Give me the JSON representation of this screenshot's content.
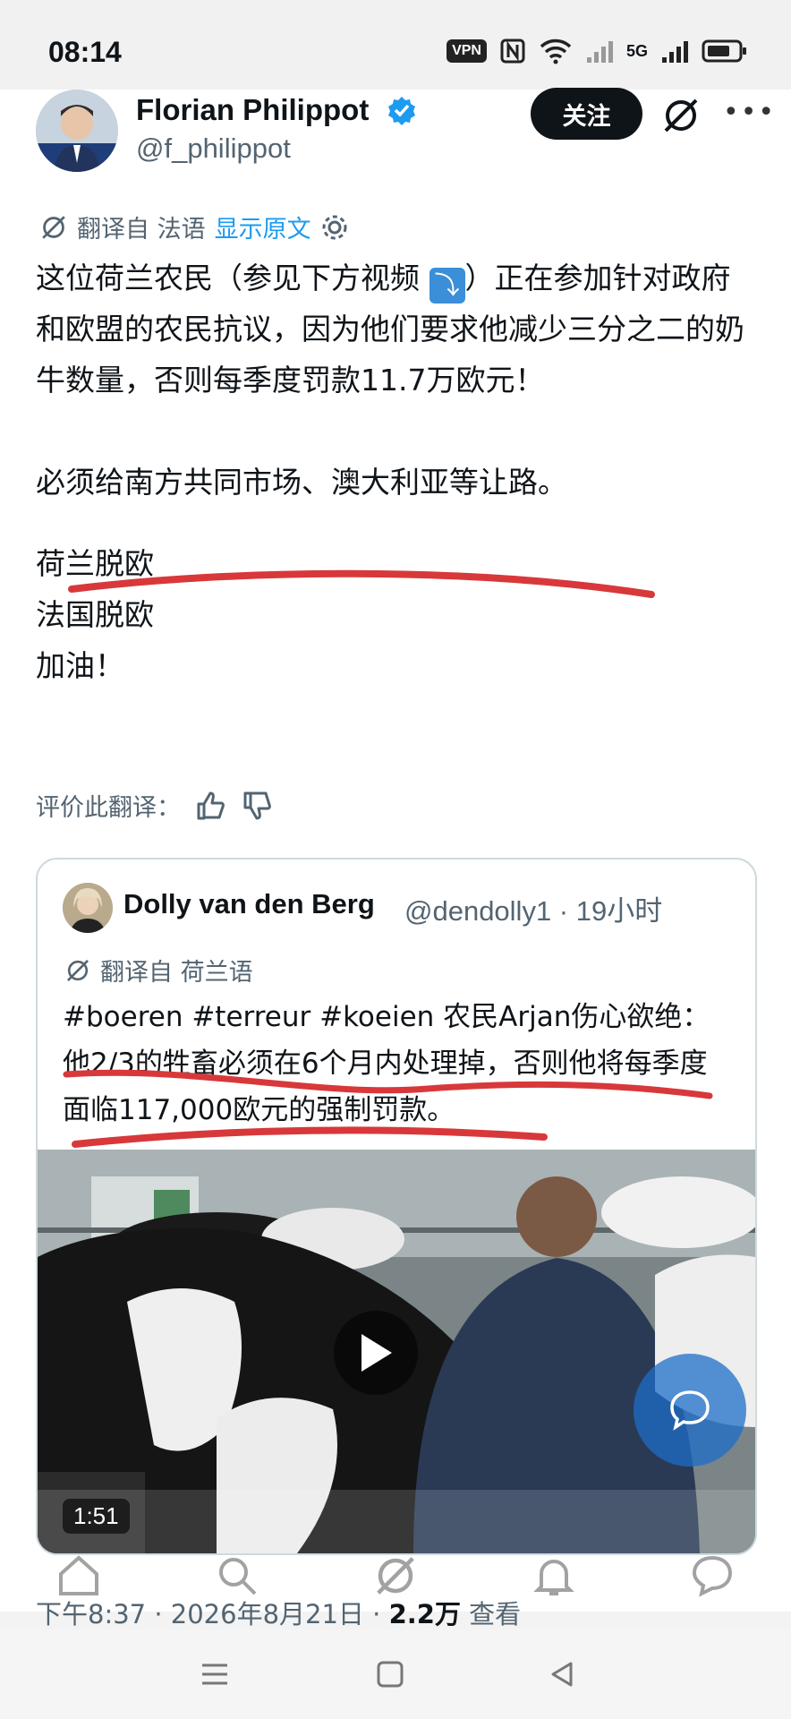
{
  "status_bar": {
    "time": "08:14",
    "vpn": "VPN",
    "signal_label": "5G"
  },
  "author": {
    "name": "Florian Philippot",
    "handle": "@f_philippot",
    "follow_label": "关注"
  },
  "translation": {
    "prefix": "翻译自 法语",
    "show_original": "显示原文"
  },
  "tweet": {
    "line1_a": "这位荷兰农民（参见下方视频",
    "arrow_glyph": "⤵",
    "line1_b": "）正在参加针对政府和欧盟的农民抗议，因为他们要求他减少三分之二的奶牛数量，否则每季度罚款11.7万欧元！",
    "paragraph2": "必须给南方共同市场、澳大利亚等让路。",
    "line3": "荷兰脱欧",
    "line4": "法国脱欧",
    "line5": "加油！"
  },
  "rate_translation": "评价此翻译：",
  "quote": {
    "name": "Dolly van den Berg",
    "handle_time": "@dendolly1 · 19小时",
    "translation_prefix": "翻译自 荷兰语",
    "text": "#boeren #terreur #koeien 农民Arjan伤心欲绝：他2/3的牲畜必须在6个月内处理掉，否则他将每季度面临117,000欧元的强制罚款。",
    "video_duration": "1:51"
  },
  "meta": {
    "time_date": "下午8:37 · 2026年8月21日 · ",
    "views_count": "2.2万",
    "views_label": " 查看"
  },
  "colors": {
    "link": "#1d9bf0",
    "annotation": "#d8383a",
    "verified": "#1d9bf0"
  }
}
